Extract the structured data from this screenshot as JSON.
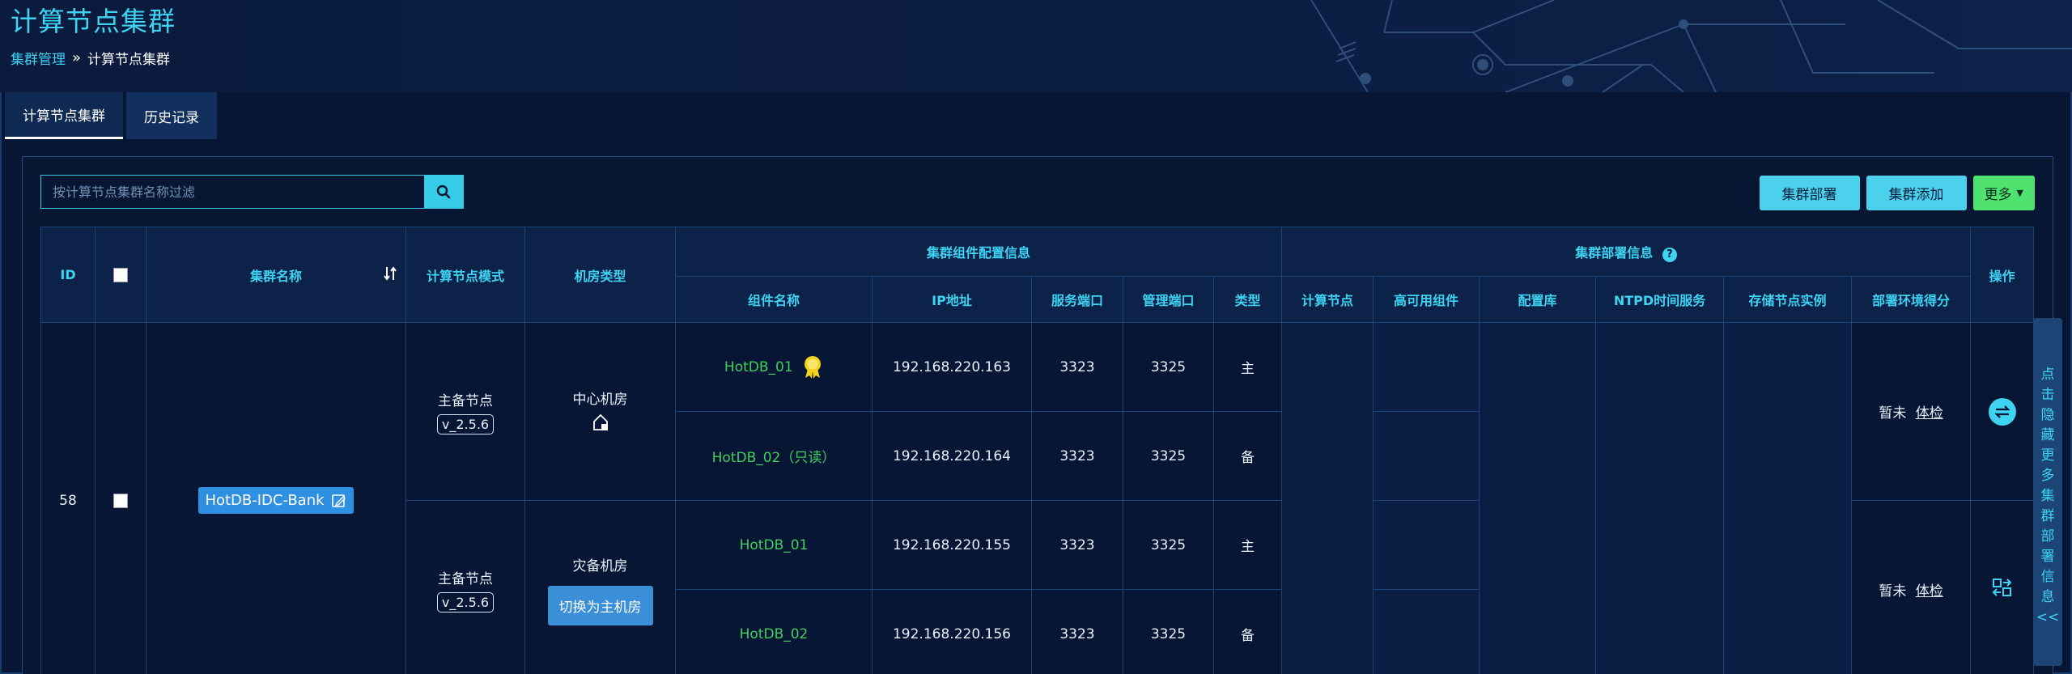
{
  "header": {
    "title": "计算节点集群",
    "breadcrumb": {
      "parent": "集群管理",
      "separator": "»",
      "current": "计算节点集群"
    }
  },
  "tabs": [
    {
      "label": "计算节点集群",
      "active": true
    },
    {
      "label": "历史记录",
      "active": false
    }
  ],
  "search": {
    "placeholder": "按计算节点集群名称过滤",
    "value": ""
  },
  "toolbar": {
    "deploy": "集群部署",
    "add": "集群添加",
    "more": "更多"
  },
  "table": {
    "headers": {
      "id": "ID",
      "name": "集群名称",
      "mode": "计算节点模式",
      "room_type": "机房类型",
      "component_group": "集群组件配置信息",
      "deploy_group": "集群部署信息",
      "help": "?",
      "operation": "操作",
      "comp_name": "组件名称",
      "ip": "IP地址",
      "service_port": "服务端口",
      "mgmt_port": "管理端口",
      "type": "类型",
      "compute_node": "计算节点",
      "ha_component": "高可用组件",
      "config_db": "配置库",
      "ntpd": "NTPD时间服务",
      "storage": "存储节点实例",
      "score": "部署环境得分"
    },
    "cluster": {
      "id": "58",
      "name": "HotDB-IDC-Bank"
    },
    "groups": [
      {
        "mode": "主备节点",
        "version": "v_2.5.6",
        "room": "中心机房",
        "room_action": "",
        "score_text": "暂未",
        "score_link": "体检",
        "rows": [
          {
            "comp": "HotDB_01",
            "ip": "192.168.220.163",
            "sport": "3323",
            "mport": "3325",
            "type": "主"
          },
          {
            "comp": "HotDB_02（只读）",
            "ip": "192.168.220.164",
            "sport": "3323",
            "mport": "3325",
            "type": "备"
          }
        ]
      },
      {
        "mode": "主备节点",
        "version": "v_2.5.6",
        "room": "灾备机房",
        "room_action": "切换为主机房",
        "score_text": "暂未",
        "score_link": "体检",
        "rows": [
          {
            "comp": "HotDB_01",
            "ip": "192.168.220.155",
            "sport": "3323",
            "mport": "3325",
            "type": "主"
          },
          {
            "comp": "HotDB_02",
            "ip": "192.168.220.156",
            "sport": "3323",
            "mport": "3325",
            "type": "备"
          }
        ]
      }
    ]
  },
  "side_panel": {
    "label": "点击隐藏更多集群部署信息<<"
  },
  "colors": {
    "accent": "#3fd3f2",
    "green": "#3ecf5d",
    "panel_bg": "#071634"
  }
}
